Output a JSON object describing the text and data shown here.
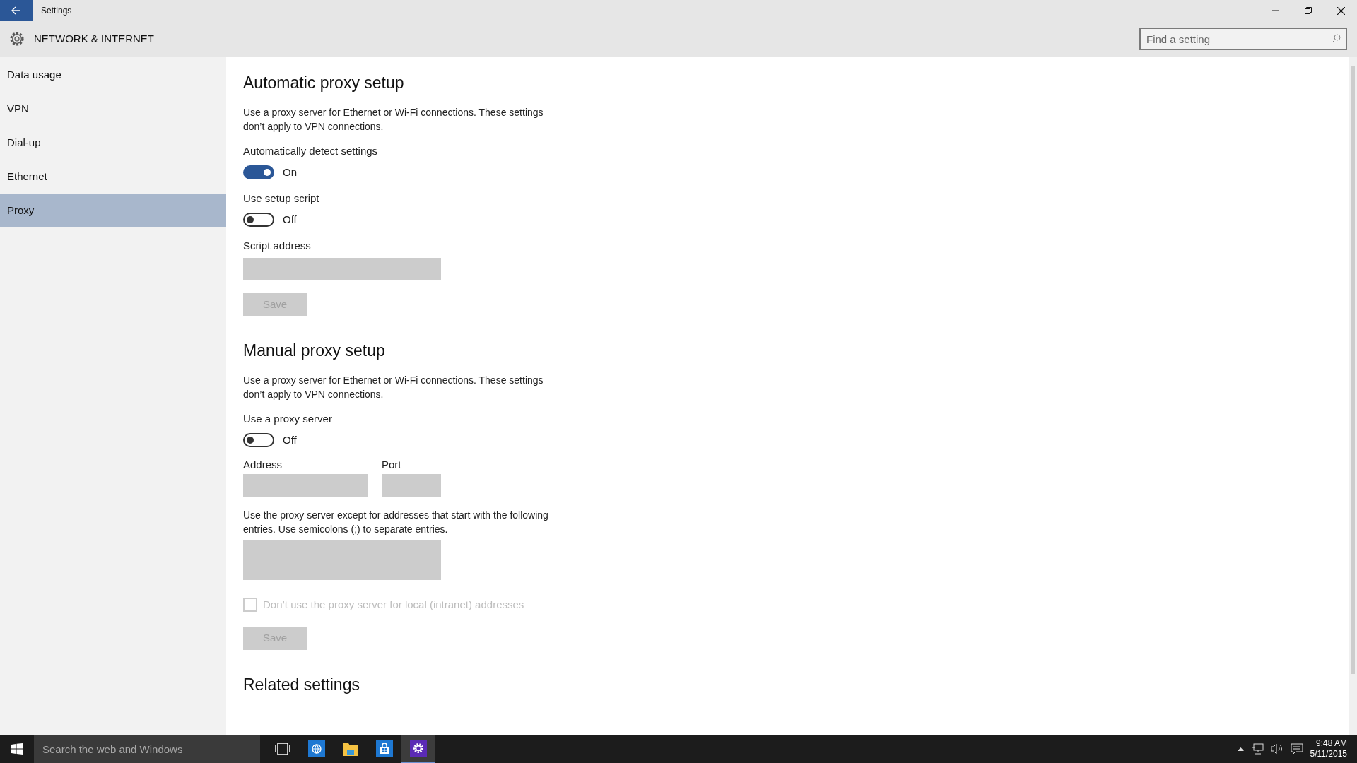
{
  "window": {
    "title": "Settings"
  },
  "header": {
    "title": "NETWORK & INTERNET",
    "search": {
      "placeholder": "Find a setting"
    }
  },
  "sidebar": {
    "items": [
      {
        "label": "Data usage",
        "selected": false
      },
      {
        "label": "VPN",
        "selected": false
      },
      {
        "label": "Dial-up",
        "selected": false
      },
      {
        "label": "Ethernet",
        "selected": false
      },
      {
        "label": "Proxy",
        "selected": true
      }
    ]
  },
  "automatic": {
    "heading": "Automatic proxy setup",
    "description": "Use a proxy server for Ethernet or Wi-Fi connections. These settings don’t apply to VPN connections.",
    "toggles": [
      {
        "label": "Automatically detect settings",
        "on": true,
        "state_text": "On"
      },
      {
        "label": "Use setup script",
        "on": false,
        "state_text": "Off"
      }
    ],
    "script_address": {
      "label": "Script address"
    },
    "save": {
      "label": "Save",
      "disabled": true
    }
  },
  "manual": {
    "heading": "Manual proxy setup",
    "description": "Use a proxy server for Ethernet or Wi-Fi connections. These settings don’t apply to VPN connections.",
    "toggle": {
      "label": "Use a proxy server",
      "on": false,
      "state_text": "Off"
    },
    "address": {
      "label": "Address"
    },
    "port": {
      "label": "Port"
    },
    "exceptions": {
      "label": "Use the proxy server except for addresses that start with the following entries. Use semicolons (;) to separate entries."
    },
    "local_checkbox": {
      "label": "Don’t use the proxy server for local (intranet) addresses",
      "checked": false,
      "disabled": true
    },
    "save": {
      "label": "Save",
      "disabled": true
    }
  },
  "related": {
    "heading": "Related settings"
  },
  "taskbar": {
    "search": {
      "placeholder": "Search the web and Windows"
    },
    "apps": [
      {
        "kind": "task-view",
        "selected": false
      },
      {
        "kind": "browser",
        "selected": false
      },
      {
        "kind": "folder",
        "selected": false
      },
      {
        "kind": "store",
        "selected": false
      },
      {
        "kind": "settings",
        "selected": true
      }
    ],
    "clock": {
      "time": "9:48 AM",
      "date": "5/11/2015"
    }
  }
}
